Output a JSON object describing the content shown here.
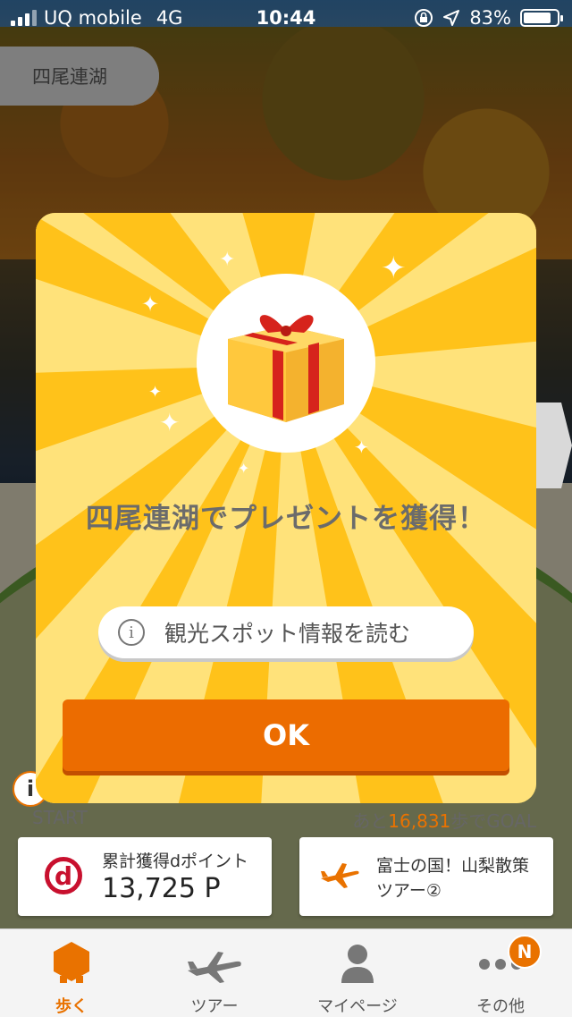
{
  "status_bar": {
    "carrier": "UQ mobile",
    "network": "4G",
    "time": "10:44",
    "battery": "83%"
  },
  "location_tab": {
    "label": "四尾連湖"
  },
  "progress": {
    "start_label": "START",
    "goal_prefix": "あと",
    "steps_remaining": "16,831",
    "goal_suffix": "歩でGOAL"
  },
  "points_card": {
    "label": "累計獲得dポイント",
    "value": "13,725 P",
    "logo_letter": "d"
  },
  "tour_card": {
    "label": "富士の国！山梨散策ツアー②"
  },
  "tabs": [
    {
      "label": "歩く",
      "icon": "walk-icon",
      "active": true
    },
    {
      "label": "ツアー",
      "icon": "plane-icon",
      "active": false
    },
    {
      "label": "マイページ",
      "icon": "person-icon",
      "active": false
    },
    {
      "label": "その他",
      "icon": "more-icon",
      "active": false,
      "badge": "N"
    }
  ],
  "modal": {
    "title": "四尾連湖でプレゼントを獲得！",
    "spot_button_label": "観光スポット情報を読む",
    "ok_label": "OK"
  },
  "colors": {
    "accent": "#ec6c00",
    "modal_bg": "#ffd84a",
    "d_point_red": "#c8102e"
  }
}
